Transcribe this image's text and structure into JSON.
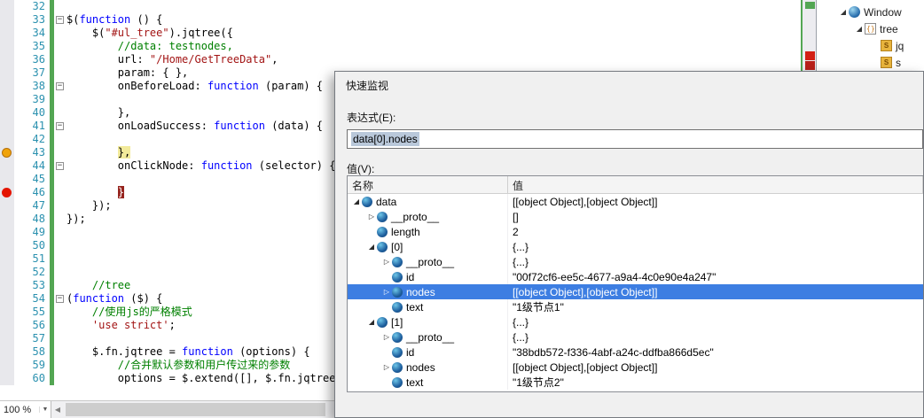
{
  "colors": {
    "selection_blue": "#3D7EE2",
    "breakpoint_red": "#E41400",
    "tracepoint_orange": "#F0A30A",
    "change_bar_green": "#53A653",
    "keyword_blue": "#0000FF",
    "string_red": "#A31515",
    "comment_green": "#008000",
    "line_number_teal": "#2B91AF",
    "statement_highlight_yellow": "#F2EA9A",
    "breakpoint_line_maroon": "#96241E"
  },
  "editor": {
    "zoom_label": "100 %",
    "lines": [
      {
        "n": 32,
        "segs": []
      },
      {
        "n": 33,
        "fold": true,
        "segs": [
          {
            "t": "$(",
            "c": "p"
          },
          {
            "t": "function",
            "c": "k"
          },
          {
            "t": " () {",
            "c": "p"
          }
        ]
      },
      {
        "n": 34,
        "segs": [
          {
            "t": "    $(",
            "c": "p"
          },
          {
            "t": "\"#ul_tree\"",
            "c": "s"
          },
          {
            "t": ").jqtree({",
            "c": "p"
          }
        ]
      },
      {
        "n": 35,
        "segs": [
          {
            "t": "        ",
            "c": "p"
          },
          {
            "t": "//data: testnodes,",
            "c": "c"
          }
        ]
      },
      {
        "n": 36,
        "segs": [
          {
            "t": "        url: ",
            "c": "p"
          },
          {
            "t": "\"/Home/GetTreeData\"",
            "c": "s"
          },
          {
            "t": ",",
            "c": "p"
          }
        ]
      },
      {
        "n": 37,
        "segs": [
          {
            "t": "        param: { },",
            "c": "p"
          }
        ]
      },
      {
        "n": 38,
        "fold": true,
        "segs": [
          {
            "t": "        onBeforeLoad: ",
            "c": "p"
          },
          {
            "t": "function",
            "c": "k"
          },
          {
            "t": " (param) {",
            "c": "p"
          }
        ]
      },
      {
        "n": 39,
        "segs": []
      },
      {
        "n": 40,
        "segs": [
          {
            "t": "        },",
            "c": "p"
          }
        ]
      },
      {
        "n": 41,
        "fold": true,
        "segs": [
          {
            "t": "        onLoadSuccess: ",
            "c": "p"
          },
          {
            "t": "function",
            "c": "k"
          },
          {
            "t": " (data) {",
            "c": "p"
          }
        ]
      },
      {
        "n": 42,
        "segs": []
      },
      {
        "n": 43,
        "bp": "active",
        "segs": [
          {
            "t": "        ",
            "c": "p"
          },
          {
            "t": "},",
            "c": "hy"
          }
        ]
      },
      {
        "n": 44,
        "fold": true,
        "segs": [
          {
            "t": "        onClickNode: ",
            "c": "p"
          },
          {
            "t": "function",
            "c": "k"
          },
          {
            "t": " (selector) {",
            "c": "p"
          }
        ]
      },
      {
        "n": 45,
        "segs": []
      },
      {
        "n": 46,
        "bp": "normal",
        "segs": [
          {
            "t": "        ",
            "c": "p"
          },
          {
            "t": "}",
            "c": "hr"
          }
        ]
      },
      {
        "n": 47,
        "segs": [
          {
            "t": "    });",
            "c": "p"
          }
        ]
      },
      {
        "n": 48,
        "segs": [
          {
            "t": "});",
            "c": "p"
          }
        ]
      },
      {
        "n": 49,
        "segs": []
      },
      {
        "n": 50,
        "segs": []
      },
      {
        "n": 51,
        "segs": []
      },
      {
        "n": 52,
        "segs": []
      },
      {
        "n": 53,
        "segs": [
          {
            "t": "    ",
            "c": "p"
          },
          {
            "t": "//tree",
            "c": "c"
          }
        ]
      },
      {
        "n": 54,
        "fold": true,
        "segs": [
          {
            "t": "(",
            "c": "p"
          },
          {
            "t": "function",
            "c": "k"
          },
          {
            "t": " ($) {",
            "c": "p"
          }
        ]
      },
      {
        "n": 55,
        "segs": [
          {
            "t": "    ",
            "c": "p"
          },
          {
            "t": "//使用js的严格模式",
            "c": "c"
          }
        ]
      },
      {
        "n": 56,
        "segs": [
          {
            "t": "    ",
            "c": "p"
          },
          {
            "t": "'use strict'",
            "c": "s"
          },
          {
            "t": ";",
            "c": "p"
          }
        ]
      },
      {
        "n": 57,
        "segs": []
      },
      {
        "n": 58,
        "segs": [
          {
            "t": "    $.fn.jqtree = ",
            "c": "p"
          },
          {
            "t": "function",
            "c": "k"
          },
          {
            "t": " (options) {",
            "c": "p"
          }
        ]
      },
      {
        "n": 59,
        "segs": [
          {
            "t": "        ",
            "c": "p"
          },
          {
            "t": "//合并默认参数和用户传过来的参数",
            "c": "c"
          }
        ]
      },
      {
        "n": 60,
        "segs": [
          {
            "t": "        options = $.extend([], $.fn.jqtree",
            "c": "p"
          }
        ]
      }
    ]
  },
  "solution_explorer": {
    "items": [
      {
        "label": "Window",
        "depth": 0,
        "glyph": "exp",
        "icon": "web"
      },
      {
        "label": "tree",
        "depth": 1,
        "glyph": "exp",
        "icon": "doc"
      },
      {
        "label": "jq",
        "depth": 2,
        "glyph": "",
        "icon": "js"
      },
      {
        "label": "s",
        "depth": 2,
        "glyph": "",
        "icon": "js"
      }
    ]
  },
  "quickwatch": {
    "title": "快速监视",
    "expression_label": "表达式(E):",
    "expression_value": "data[0].nodes",
    "value_label": "值(V):",
    "grid": {
      "columns": [
        "名称",
        "值"
      ],
      "rows": [
        {
          "depth": 0,
          "glyph": "exp",
          "name": "data",
          "value": "[[object Object],[object Object]]",
          "selected": false
        },
        {
          "depth": 1,
          "glyph": "col",
          "name": "__proto__",
          "value": "[]",
          "selected": false
        },
        {
          "depth": 1,
          "glyph": "",
          "name": "length",
          "value": "2",
          "selected": false
        },
        {
          "depth": 1,
          "glyph": "exp",
          "name": "[0]",
          "value": "{...}",
          "selected": false
        },
        {
          "depth": 2,
          "glyph": "col",
          "name": "__proto__",
          "value": "{...}",
          "selected": false
        },
        {
          "depth": 2,
          "glyph": "",
          "name": "id",
          "value": "\"00f72cf6-ee5c-4677-a9a4-4c0e90e4a247\"",
          "selected": false
        },
        {
          "depth": 2,
          "glyph": "col",
          "name": "nodes",
          "value": "[[object Object],[object Object]]",
          "selected": true
        },
        {
          "depth": 2,
          "glyph": "",
          "name": "text",
          "value": "\"1级节点1\"",
          "selected": false
        },
        {
          "depth": 1,
          "glyph": "exp",
          "name": "[1]",
          "value": "{...}",
          "selected": false
        },
        {
          "depth": 2,
          "glyph": "col",
          "name": "__proto__",
          "value": "{...}",
          "selected": false
        },
        {
          "depth": 2,
          "glyph": "",
          "name": "id",
          "value": "\"38bdb572-f336-4abf-a24c-ddfba866d5ec\"",
          "selected": false
        },
        {
          "depth": 2,
          "glyph": "col",
          "name": "nodes",
          "value": "[[object Object],[object Object]]",
          "selected": false
        },
        {
          "depth": 2,
          "glyph": "",
          "name": "text",
          "value": "\"1级节点2\"",
          "selected": false
        }
      ]
    }
  }
}
